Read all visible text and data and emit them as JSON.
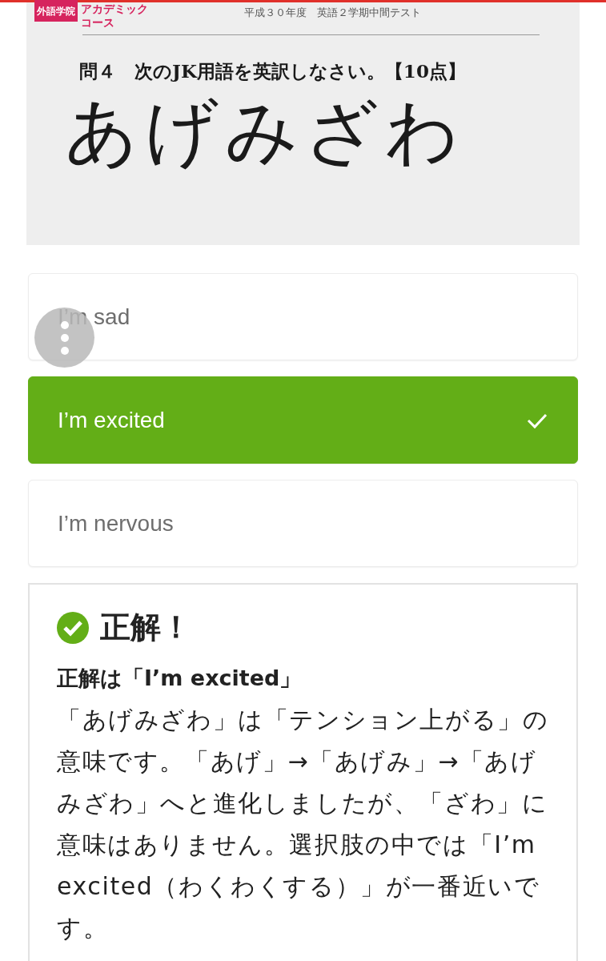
{
  "exam_sheet": {
    "school_name": "外語学院",
    "course_lines": [
      "アカデミック",
      "コース"
    ],
    "header": "平成３０年度　英語２学期中間テスト",
    "question": "問４　次のJK用語を英訳しなさい。【10点】",
    "word": "あげみざわ"
  },
  "choices": [
    {
      "label": "I’m sad",
      "selected": false
    },
    {
      "label": "I’m excited",
      "selected": true
    },
    {
      "label": "I’m nervous",
      "selected": false
    }
  ],
  "result": {
    "title": "正解！",
    "answer": "正解は「I’m excited」",
    "explanation": "「あげみざわ」は「テンション上がる」の意味です。「あげ」→「あげみ」→「あげみざわ」へと進化しましたが、「ざわ」に意味はありません。選択肢の中では「I’m excited（わくわくする）」が一番近いです。"
  }
}
